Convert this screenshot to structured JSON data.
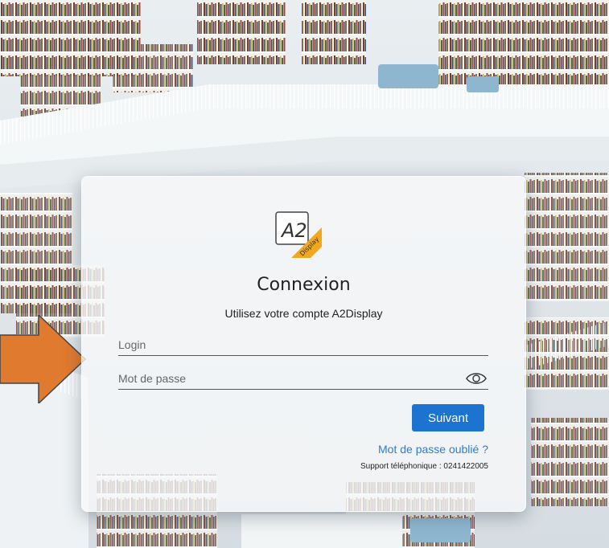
{
  "login_card": {
    "title": "Connexion",
    "subtitle": "Utilisez votre compte A2Display",
    "login_placeholder": "Login",
    "password_placeholder": "Mot de passe",
    "next_button": "Suivant",
    "forgot_password_link": "Mot de passe oublié ?",
    "support_text": "Support téléphonique : 0241422005",
    "logo": {
      "brand": "A2",
      "tagline": "Display"
    },
    "eye_icon": "eye-icon"
  },
  "annotation": {
    "icon": "arrow-right-icon",
    "color": "#e07a2e"
  },
  "colors": {
    "primary_button": "#1d73d0",
    "link": "#2b7fd6",
    "logo_accent": "#f2a81d"
  }
}
